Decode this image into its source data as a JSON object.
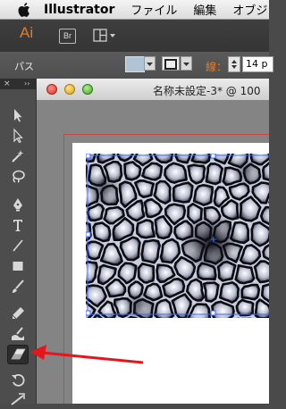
{
  "menubar": {
    "apple_icon": "apple-logo-icon",
    "app_name": "Illustrator",
    "items": [
      "ファイル",
      "編集",
      "オブジ"
    ]
  },
  "appbar": {
    "logo": "Ai",
    "bridge_button": "Br",
    "arrange_icon": "arrange-documents-icon"
  },
  "controlbar": {
    "selection_label": "パス",
    "fill_color": "#b0c4d8",
    "stroke_label": "線：",
    "stroke_value": "14 p"
  },
  "tools": {
    "header_close": "×",
    "header_collapse": "››",
    "items": [
      "selection-tool-icon",
      "direct-selection-tool-icon",
      "magic-wand-tool-icon",
      "lasso-tool-icon",
      "pen-tool-icon",
      "type-tool-icon",
      "line-segment-tool-icon",
      "rectangle-tool-icon",
      "paintbrush-tool-icon",
      "pencil-tool-icon",
      "blob-brush-tool-icon",
      "eraser-tool-icon",
      "rotate-tool-icon",
      "width-tool-icon"
    ],
    "selected": "eraser-tool-icon"
  },
  "document": {
    "title": "名称未設定-3* @ 100",
    "artboard_border_color": "#cc4444",
    "image_description_icon": "voronoi-pattern-image"
  },
  "annotation": {
    "arrow_color": "#e8141c"
  }
}
